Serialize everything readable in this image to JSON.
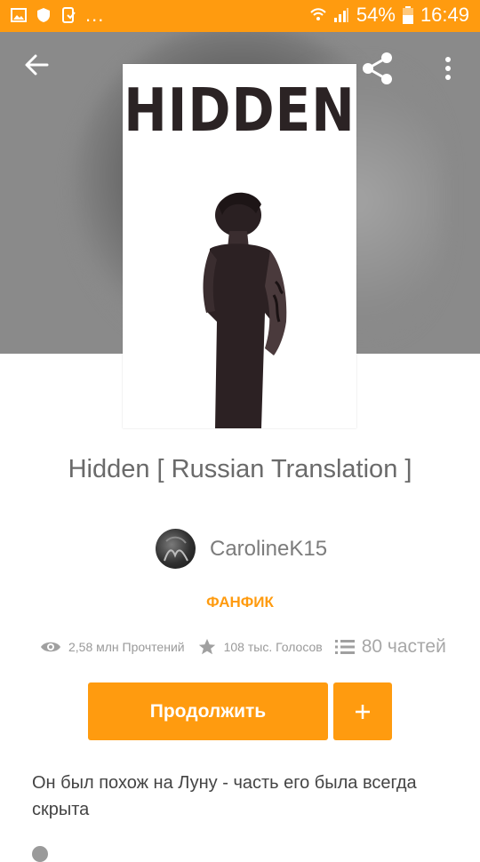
{
  "status_bar": {
    "battery_percent": "54%",
    "time": "16:49",
    "more": "..."
  },
  "story": {
    "cover_title": "HIDDEN",
    "title": "Hidden [ Russian Translation ]",
    "author": "CarolineK15",
    "category": "ФАНФИК",
    "reads": "2,58 млн Прочтений",
    "votes": "108 тыс. Голосов",
    "parts": "80 частей",
    "description": "Он был похож на Луну - часть его была всегда скрыта"
  },
  "actions": {
    "continue_label": "Продолжить",
    "add_label": "+"
  },
  "colors": {
    "accent": "#ff9b0f",
    "text_primary": "#444444",
    "text_secondary": "#9a9a9a"
  },
  "icons": [
    "back-arrow-icon",
    "share-icon",
    "more-vert-icon",
    "eye-icon",
    "star-icon",
    "list-icon",
    "plus-icon"
  ]
}
